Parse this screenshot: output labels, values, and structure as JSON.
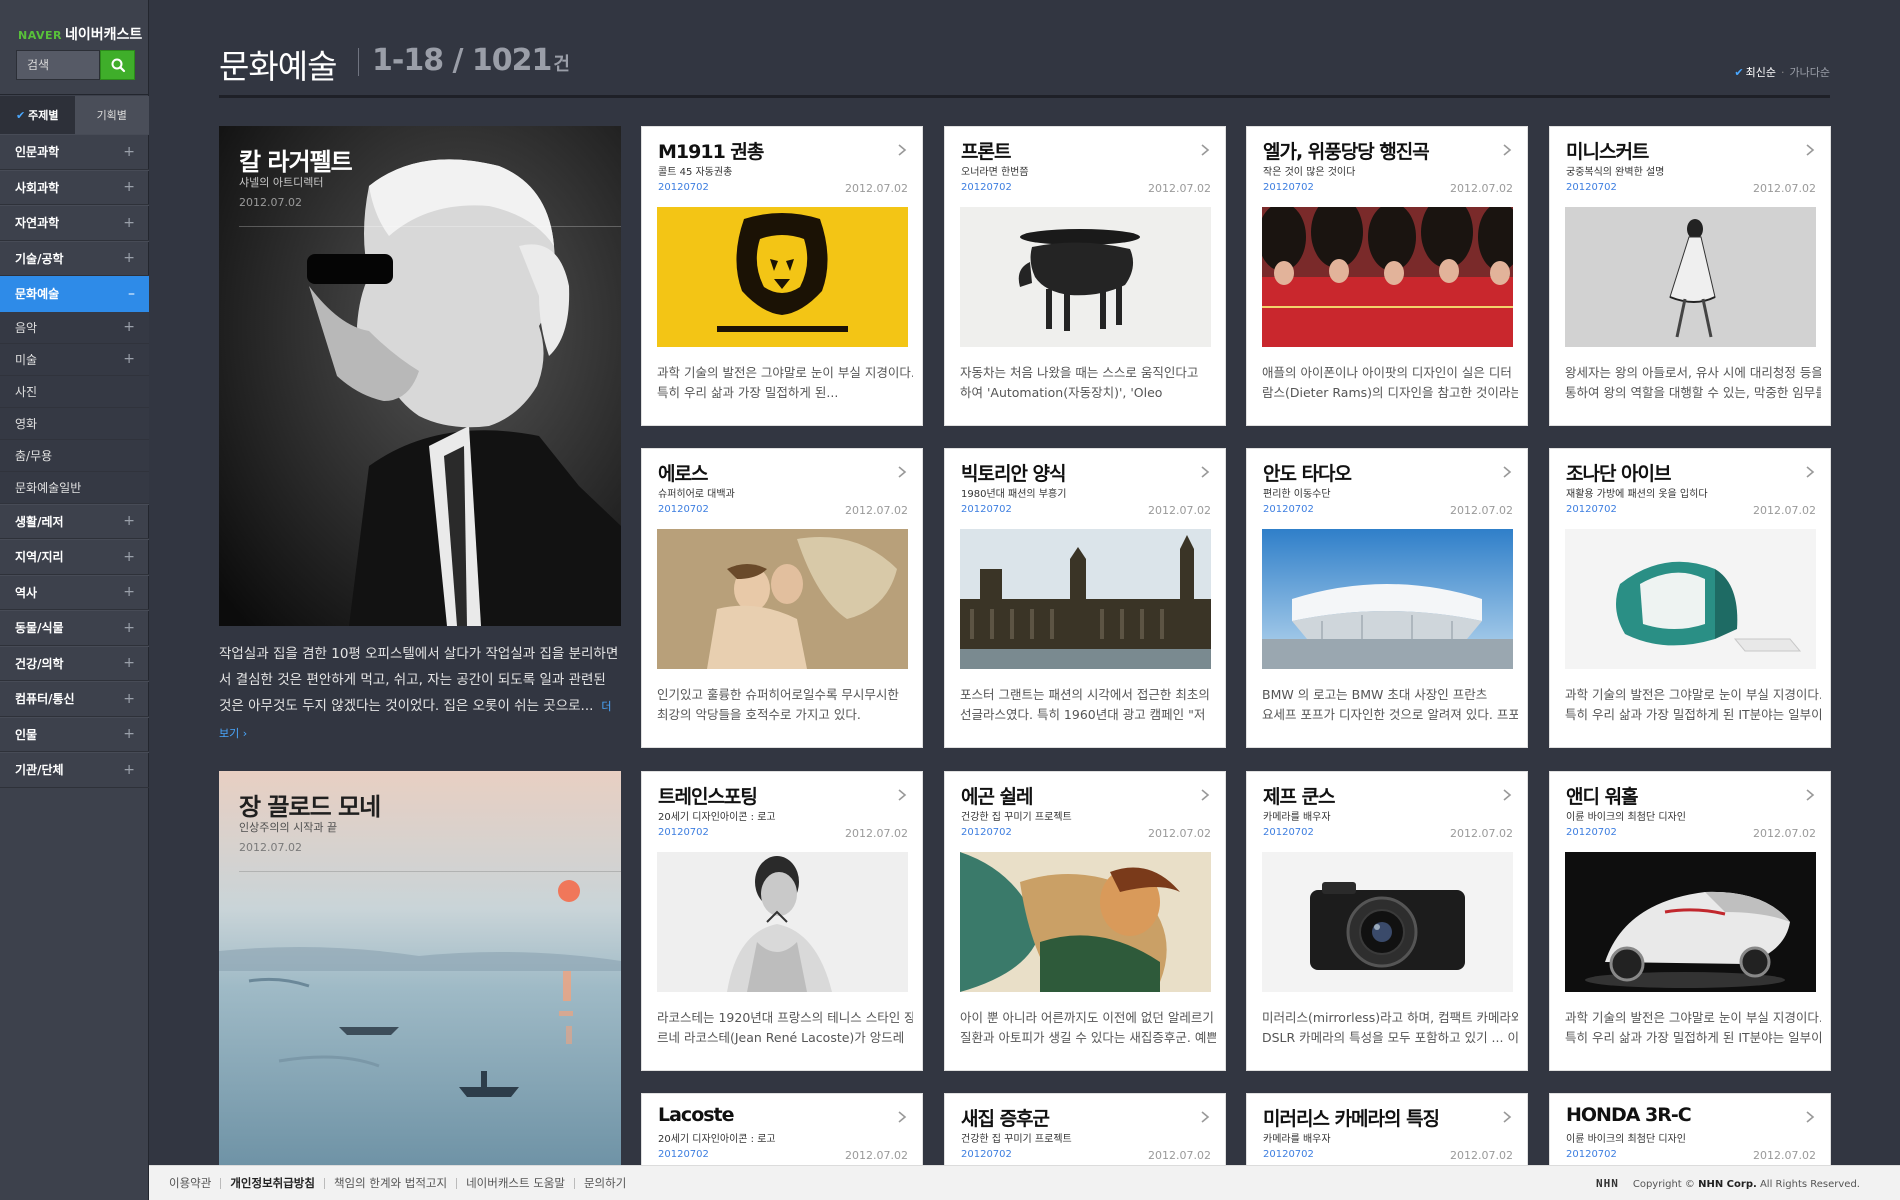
{
  "brand": {
    "naver": "NAVER",
    "service": "네이버캐스트"
  },
  "search": {
    "placeholder": "검색"
  },
  "side_tabs": [
    {
      "label": "주제별"
    },
    {
      "label": "기획별"
    }
  ],
  "menu": [
    {
      "label": "인문과학",
      "icon": "+"
    },
    {
      "label": "사회과학",
      "icon": "+"
    },
    {
      "label": "자연과학",
      "icon": "+"
    },
    {
      "label": "기술/공학",
      "icon": "+"
    },
    {
      "label": "문화예술",
      "icon": "–"
    }
  ],
  "submenu": [
    {
      "label": "음악",
      "icon": "+"
    },
    {
      "label": "미술",
      "icon": "+"
    },
    {
      "label": "사진",
      "icon": ""
    },
    {
      "label": "영화",
      "icon": ""
    },
    {
      "label": "춤/무용",
      "icon": ""
    },
    {
      "label": "문화예술일반",
      "icon": ""
    }
  ],
  "menu2": [
    {
      "label": "생활/레저",
      "icon": "+"
    },
    {
      "label": "지역/지리",
      "icon": "+"
    },
    {
      "label": "역사",
      "icon": "+"
    },
    {
      "label": "동물/식물",
      "icon": "+"
    },
    {
      "label": "건강/의학",
      "icon": "+"
    },
    {
      "label": "컴퓨터/통신",
      "icon": "+"
    },
    {
      "label": "인물",
      "icon": "+"
    },
    {
      "label": "기관/단체",
      "icon": "+"
    }
  ],
  "header": {
    "title": "문화예술",
    "range": "1-18 / 1021",
    "unit": "건",
    "sort_active": "최신순",
    "sort_other": "가나다순"
  },
  "featured": [
    {
      "title": "칼 라거펠트",
      "subtitle": "샤넬의 아트디렉터",
      "date": "2012.07.02",
      "desc": "작업실과 집을 겸한 10평 오피스텔에서 살다가 작업실과 집을 분리하면서 결심한 것은 편안하게 먹고, 쉬고, 자는 공간이 되도록 일과 관련된 것은 아무것도 두지 않겠다는 것이었다. 집은 오롯이 쉬는 곳으로...",
      "more": "더보기 ›"
    },
    {
      "title": "장 끌로드 모네",
      "subtitle": "인상주의의 시작과 끝",
      "date": "2012.07.02"
    }
  ],
  "cards": [
    {
      "title": "M1911 권총",
      "subtitle": "콜트 45 자동권총",
      "date1": "20120702",
      "date2": "2012.07.02",
      "desc1": "과학 기술의 발전은 그야말로 눈이 부실 지경이다.",
      "desc2": "특히 우리 삶과 가장 밀접하게 된..."
    },
    {
      "title": "프론트",
      "subtitle": "오너라면 한번쯤",
      "date1": "20120702",
      "date2": "2012.07.02",
      "desc1": "자동차는 처음 나왔을 때는 스스로 움직인다고",
      "desc2": "하여 'Automation(자동장치)', 'Oleo"
    },
    {
      "title": "엘가, 위풍당당 행진곡",
      "subtitle": "작은 것이 많은 것이다",
      "date1": "20120702",
      "date2": "2012.07.02",
      "desc1": "애플의 아이폰이나 아이팟의 디자인이 실은 디터",
      "desc2": "람스(Dieter Rams)의 디자인을 참고한 것이라는"
    },
    {
      "title": "미니스커트",
      "subtitle": "궁중복식의 완벽한 설명",
      "date1": "20120702",
      "date2": "2012.07.02",
      "desc1": "왕세자는 왕의 아들로서, 유사 시에 대리청정 등을",
      "desc2": "통하여 왕의 역할을 대행할 수 있는, 막중한 임무를"
    },
    {
      "title": "에로스",
      "subtitle": "슈퍼히어로 대백과",
      "date1": "20120702",
      "date2": "2012.07.02",
      "desc1": "인기있고 훌륭한 슈퍼히어로일수록 무시무시한",
      "desc2": "최강의 악당들을 호적수로 가지고 있다."
    },
    {
      "title": "빅토리안 양식",
      "subtitle": "1980년대 패션의 부흥기",
      "date1": "20120702",
      "date2": "2012.07.02",
      "desc1": "포스터 그랜트는 패션의 시각에서 접근한 최초의",
      "desc2": "선글라스였다. 특히 1960년대 광고 캠페인 \"저"
    },
    {
      "title": "안도 타다오",
      "subtitle": "편리한 이동수단",
      "date1": "20120702",
      "date2": "2012.07.02",
      "desc1": "BMW 의 로고는 BMW 초대 사장인 프란츠",
      "desc2": "요세프 포프가 디자인한 것으로 알려져 있다. 프포"
    },
    {
      "title": "조나단 아이브",
      "subtitle": "재활용 가방에 패션의 옷을 입히다",
      "date1": "20120702",
      "date2": "2012.07.02",
      "desc1": "과학 기술의 발전은 그야말로 눈이 부실 지경이다.",
      "desc2": "특히 우리 삶과 가장 밀접하게 된 IT분야는 일부이"
    },
    {
      "title": "트레인스포팅",
      "subtitle": "20세기 디자인아이콘 : 로고",
      "date1": "20120702",
      "date2": "2012.07.02",
      "desc1": "라코스테는 1920년대 프랑스의 테니스 스타인 장",
      "desc2": "르네 라코스테(Jean René Lacoste)가 앙드레"
    },
    {
      "title": "에곤 쉴레",
      "subtitle": "건강한 집 꾸미기 프로젝트",
      "date1": "20120702",
      "date2": "2012.07.02",
      "desc1": "아이 뿐 아니라 어른까지도 이전에 없던 알레르기",
      "desc2": "질환과 아토피가 생길 수 있다는 새집증후군. 예쁜"
    },
    {
      "title": "제프 쿤스",
      "subtitle": "카메라를 배우자",
      "date1": "20120702",
      "date2": "2012.07.02",
      "desc1": "미러리스(mirrorless)라고 하며, 컴팩트 카메라와",
      "desc2": "DSLR 카메라의 특성을 모두 포함하고 있기 ... 이"
    },
    {
      "title": "앤디 워홀",
      "subtitle": "이륜 바이크의 최첨단 디자인",
      "date1": "20120702",
      "date2": "2012.07.02",
      "desc1": "과학 기술의 발전은 그야말로 눈이 부실 지경이다.",
      "desc2": "특히 우리 삶과 가장 밀접하게 된 IT분야는 일부이"
    },
    {
      "title": "Lacoste",
      "subtitle": "20세기 디자인아이콘 : 로고",
      "date1": "20120702",
      "date2": "2012.07.02",
      "desc1": "",
      "desc2": ""
    },
    {
      "title": "새집 증후군",
      "subtitle": "건강한 집 꾸미기 프로젝트",
      "date1": "20120702",
      "date2": "2012.07.02",
      "desc1": "",
      "desc2": ""
    },
    {
      "title": "미러리스 카메라의 특징",
      "subtitle": "카메라를 배우자",
      "date1": "20120702",
      "date2": "2012.07.02",
      "desc1": "",
      "desc2": ""
    },
    {
      "title": "HONDA 3R-C",
      "subtitle": "이륜 바이크의 최첨단 디자인",
      "date1": "20120702",
      "date2": "2012.07.02",
      "desc1": "",
      "desc2": ""
    }
  ],
  "footer": {
    "links": [
      "이용약관",
      "개인정보취급방침",
      "책임의 한계와 법적고지",
      "네이버캐스트 도움말",
      "문의하기"
    ],
    "logo": "NHN",
    "copyright_pre": "Copyright ©",
    "copyright_corp": "NHN Corp.",
    "copyright_post": "All Rights Reserved."
  },
  "colors": {
    "accent": "#2e8be8",
    "naver_green": "#3fae2a",
    "bg": "#323641"
  }
}
